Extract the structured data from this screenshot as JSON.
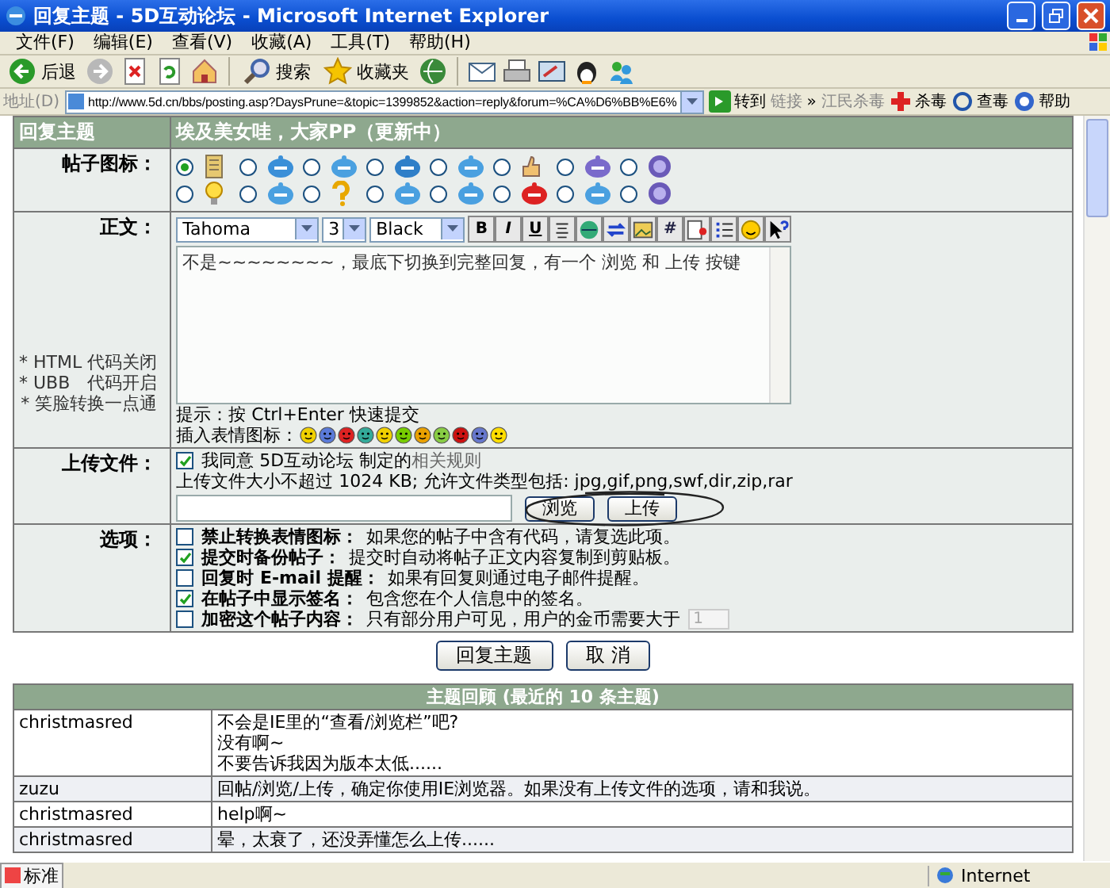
{
  "window": {
    "title": "回复主题 - 5D互动论坛 - Microsoft Internet Explorer"
  },
  "menu": [
    "文件(F)",
    "编辑(E)",
    "查看(V)",
    "收藏(A)",
    "工具(T)",
    "帮助(H)"
  ],
  "toolbar": [
    {
      "kind": "back",
      "label": "后退"
    },
    {
      "kind": "forward"
    },
    {
      "kind": "stop"
    },
    {
      "kind": "refresh"
    },
    {
      "kind": "home"
    },
    {
      "kind": "search",
      "label": "搜索"
    },
    {
      "kind": "favorites",
      "label": "收藏夹"
    },
    {
      "kind": "media"
    },
    {
      "kind": "mail"
    },
    {
      "kind": "print"
    },
    {
      "kind": "edit"
    },
    {
      "kind": "penguin"
    },
    {
      "kind": "people"
    }
  ],
  "address": {
    "label": "地址(D)",
    "url": "http://www.5d.cn/bbs/posting.asp?DaysPrune=&topic=1399852&action=reply&forum=%CA%D6%BB%E6%",
    "go": "转到",
    "links": "链接",
    "more": "»",
    "plugins": [
      {
        "kind": "plain",
        "label": "江民杀毒"
      },
      {
        "kind": "cross",
        "label": "杀毒"
      },
      {
        "kind": "scan",
        "label": "查毒"
      },
      {
        "kind": "help",
        "label": "帮助"
      }
    ]
  },
  "form": {
    "header": {
      "label": "回复主题",
      "topic": "埃及美女哇，大家PP（更新中）"
    },
    "post_icon_label": "帖子图标：",
    "post_icons": [
      {
        "selected": true
      },
      {
        "selected": false
      },
      {
        "selected": false
      },
      {
        "selected": false
      },
      {
        "selected": false
      },
      {
        "selected": false
      },
      {
        "selected": false
      },
      {
        "selected": false
      },
      {
        "selected": false
      },
      {
        "selected": false
      },
      {
        "selected": false
      },
      {
        "selected": false
      },
      {
        "selected": false
      },
      {
        "selected": false
      },
      {
        "selected": false
      },
      {
        "selected": false
      }
    ],
    "body_label": "正文：",
    "notes": [
      "* HTML 代码关闭",
      "* UBB　代码开启",
      "* 笑脸转换一点通"
    ],
    "font": "Tahoma",
    "size": "3",
    "forecolor_option": "Black",
    "editor_buttons": [
      {
        "kind": "bold",
        "label": "B"
      },
      {
        "kind": "italic",
        "label": "I"
      },
      {
        "kind": "underline",
        "label": "U"
      },
      {
        "kind": "center"
      },
      {
        "kind": "globe"
      },
      {
        "kind": "swap"
      },
      {
        "kind": "image"
      },
      {
        "kind": "hash",
        "label": "#"
      },
      {
        "kind": "media"
      },
      {
        "kind": "list"
      },
      {
        "kind": "smiley"
      },
      {
        "kind": "help"
      }
    ],
    "body": "不是~~~~~~~~，最底下切换到完整回复，有一个 浏览 和 上传 按键",
    "hint": "提示：按 Ctrl+Enter 快速提交",
    "emoticon_label": "插入表情图标：",
    "upload_label": "上传文件：",
    "agree": {
      "checked": true,
      "text": "我同意 5D互动论坛 制定的",
      "link": "相关规则"
    },
    "upload_info": "上传文件大小不超过 1024 KB; 允许文件类型包括: jpg,gif,png,swf,dir,zip,rar",
    "browse": "浏览",
    "upload": "上传",
    "options_label": "选项：",
    "options": [
      {
        "label": "禁止转换表情图标：",
        "description": "如果您的帖子中含有代码，请复选此项。",
        "checked": false
      },
      {
        "label": "提交时备份帖子：",
        "description": "提交时自动将帖子正文内容复制到剪贴板。",
        "checked": true
      },
      {
        "label": "回复时 E-mail 提醒：",
        "description": "如果有回复则通过电子邮件提醒。",
        "checked": false
      },
      {
        "label": "在帖子中显示签名：",
        "description": "包含您在个人信息中的签名。",
        "checked": true
      },
      {
        "label": "加密这个帖子内容：",
        "description": "只有部分用户可见，用户的金币需要大于",
        "checked": false,
        "select": "1"
      }
    ],
    "submit": "回复主题",
    "cancel": "取 消"
  },
  "review": {
    "title": "主题回顾 (最近的 10 条主题)",
    "rows": [
      {
        "user": "christmasred",
        "lines": [
          "不会是IE里的“查看/浏览栏”吧?",
          "没有啊~",
          "不要告诉我因为版本太低......"
        ]
      },
      {
        "user": "zuzu",
        "lines": [
          "回帖/浏览/上传，确定你使用IE浏览器。如果没有上传文件的选项，请和我说。"
        ]
      },
      {
        "user": "christmasred",
        "lines": [
          "help啊~"
        ]
      },
      {
        "user": "christmasred",
        "lines": [
          "晕，太衰了，还没弄懂怎么上传......"
        ]
      }
    ]
  },
  "status": {
    "ime": "标准",
    "zone": "Internet"
  }
}
